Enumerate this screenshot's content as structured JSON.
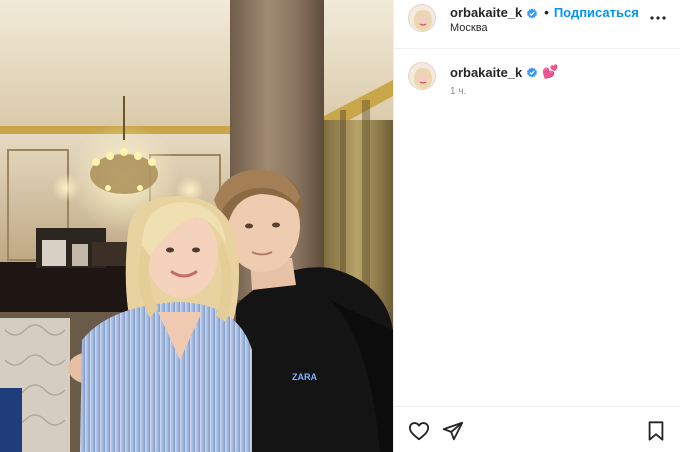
{
  "photo": {
    "alt_subject": "two people on a sofa",
    "shirt_print": "ZARA"
  },
  "header": {
    "username": "orbakaite_k",
    "separator": "•",
    "follow_label": "Подписаться",
    "location": "Москва",
    "icons": {
      "verified": "verified-badge-icon",
      "more": "more-options-icon"
    }
  },
  "caption": {
    "username": "orbakaite_k",
    "text": "💕",
    "time": "1 ч."
  },
  "actions": {
    "icons": [
      "heart-icon",
      "share-icon",
      "bookmark-icon"
    ]
  },
  "colors": {
    "accent": "#0095f6",
    "verified": "#3897f0",
    "muted": "#8e8e8e",
    "divider": "#efefef"
  }
}
